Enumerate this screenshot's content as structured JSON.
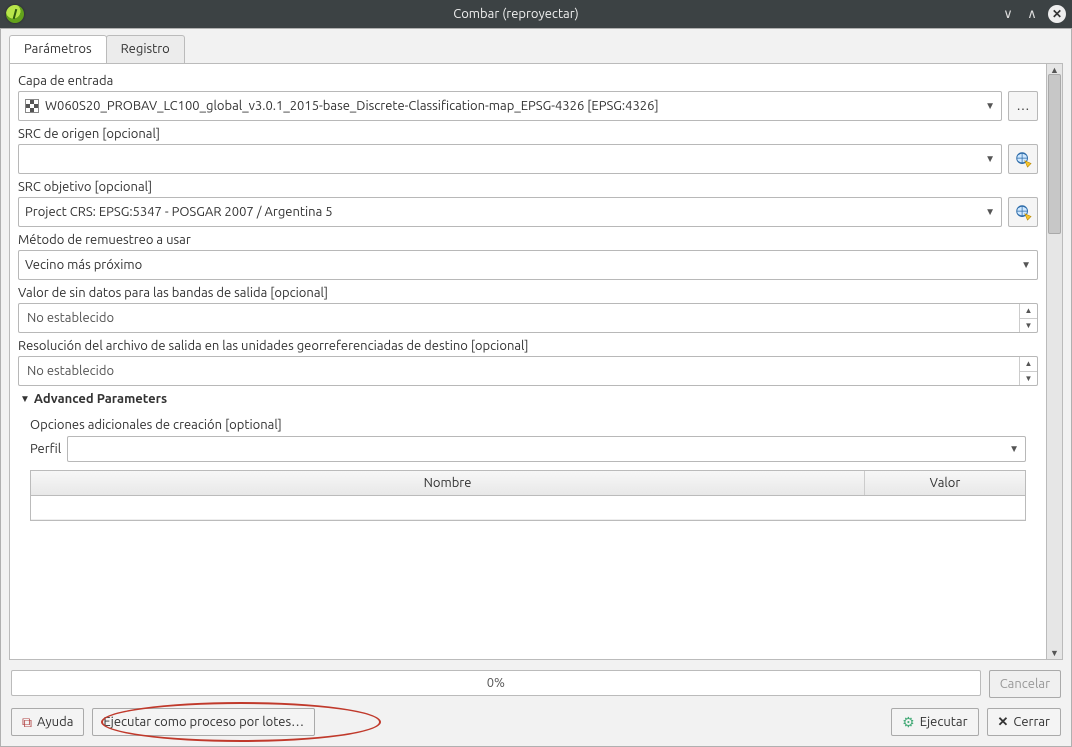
{
  "window": {
    "title": "Combar (reproyectar)"
  },
  "tabs": {
    "parameters": "Parámetros",
    "log": "Registro"
  },
  "labels": {
    "input_layer": "Capa de entrada",
    "source_crs": "SRC de origen [opcional]",
    "target_crs": "SRC objetivo [opcional]",
    "resample": "Método de remuestreo a usar",
    "nodata": "Valor de sin datos para las bandas de salida [opcional]",
    "resolution": "Resolución del archivo de salida en las unidades georreferenciadas de destino [opcional]",
    "advanced": "Advanced Parameters",
    "create_opts": "Opciones adicionales de creación [optional]",
    "profile": "Perfil"
  },
  "values": {
    "input_layer": "W060S20_PROBAV_LC100_global_v3.0.1_2015-base_Discrete-Classification-map_EPSG-4326 [EPSG:4326]",
    "source_crs": "",
    "target_crs": "Project CRS: EPSG:5347 - POSGAR 2007 / Argentina 5",
    "resample": "Vecino más próximo",
    "nodata": "No establecido",
    "resolution": "No establecido",
    "profile": ""
  },
  "table": {
    "col_name": "Nombre",
    "col_value": "Valor"
  },
  "progress": {
    "text": "0%"
  },
  "buttons": {
    "cancel": "Cancelar",
    "help": "Ayuda",
    "batch": "Ejecutar como proceso por lotes…",
    "run": "Ejecutar",
    "close": "Cerrar",
    "more": "…"
  }
}
